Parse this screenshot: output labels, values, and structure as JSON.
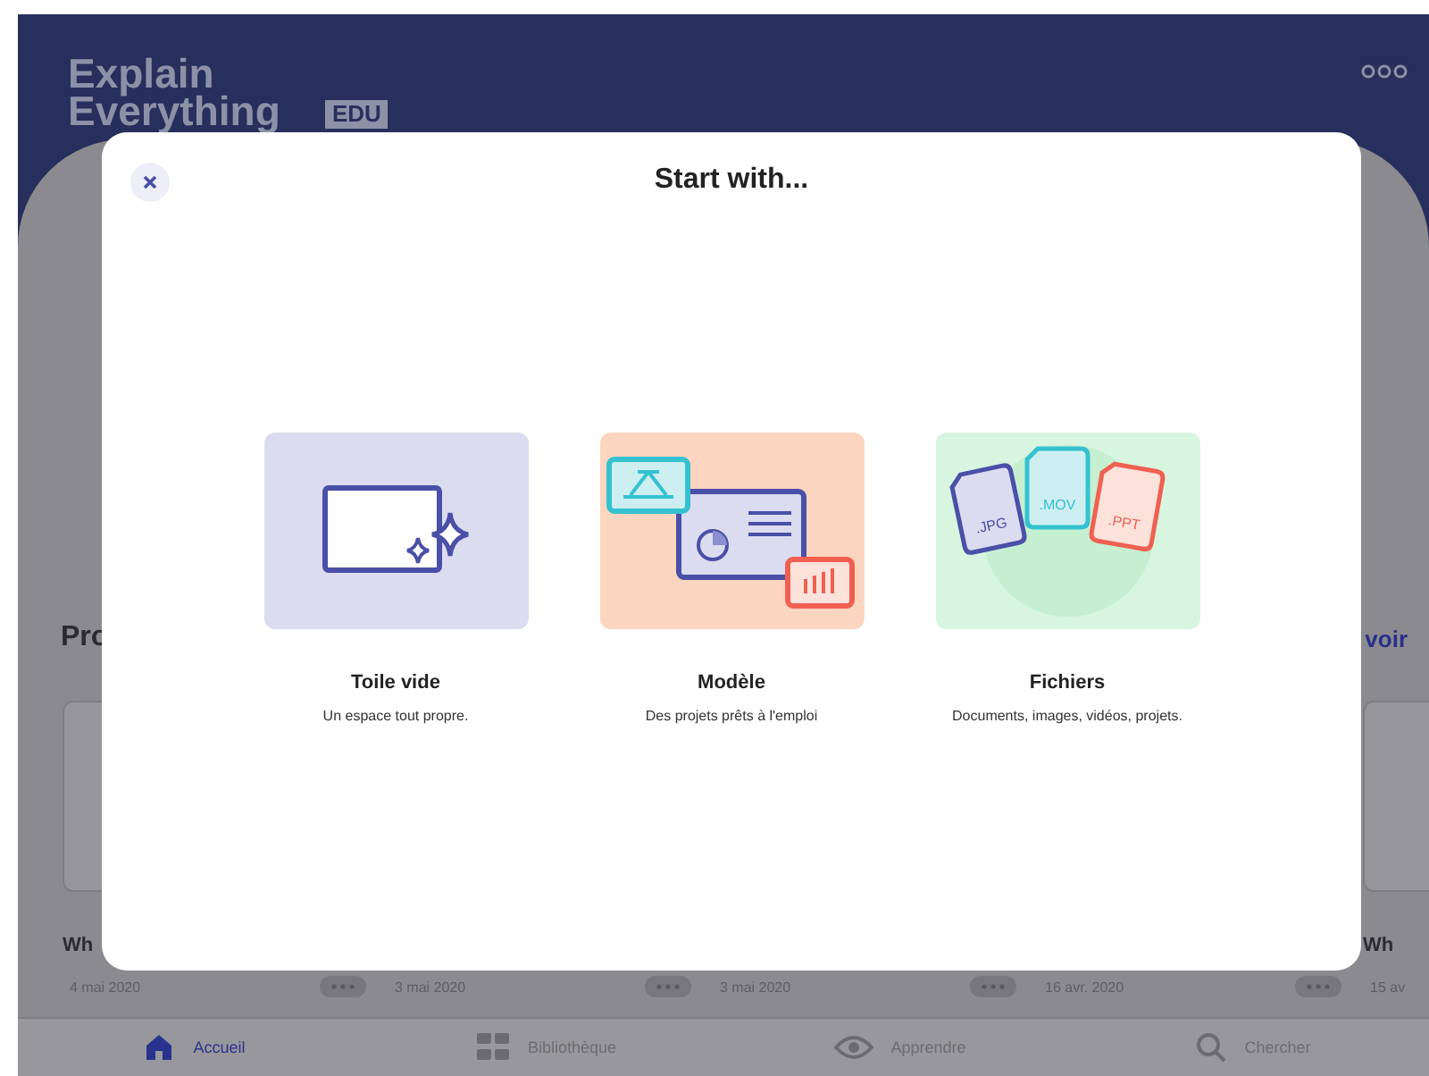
{
  "header": {
    "logo_line_1": "Explain",
    "logo_line_2": "Everything",
    "logo_badge": "EDU"
  },
  "section": {
    "title": "Pro",
    "link": "voir"
  },
  "projects": [
    {
      "title": "Wh",
      "date": "4 mai 2020"
    },
    {
      "date": "3 mai 2020"
    },
    {
      "date": "3 mai 2020"
    },
    {
      "date": "16 avr. 2020"
    },
    {
      "title": "Wh",
      "date": "15 av"
    }
  ],
  "tab_bar": [
    {
      "kind": "home",
      "label": "Accueil",
      "selected": true
    },
    {
      "kind": "library",
      "label": "Bibliothèque",
      "selected": false
    },
    {
      "kind": "learn",
      "label": "Apprendre",
      "selected": false
    },
    {
      "kind": "search",
      "label": "Chercher",
      "selected": false
    }
  ],
  "dialog": {
    "title": "Start with...",
    "options": [
      {
        "kind": "blank",
        "color": "#dcdcf0",
        "title": "Toile vide",
        "subtitle": "Un espace tout propre."
      },
      {
        "kind": "template",
        "color": "#fcd5c0",
        "title": "Modèle",
        "subtitle": "Des projets prêts à l'emploi"
      },
      {
        "kind": "files",
        "color": "#d8f5df",
        "title": "Fichiers",
        "subtitle": "Documents, images, vidéos, projets.",
        "file_types": [
          ".JPG",
          ".MOV",
          ".PPT"
        ]
      }
    ]
  }
}
